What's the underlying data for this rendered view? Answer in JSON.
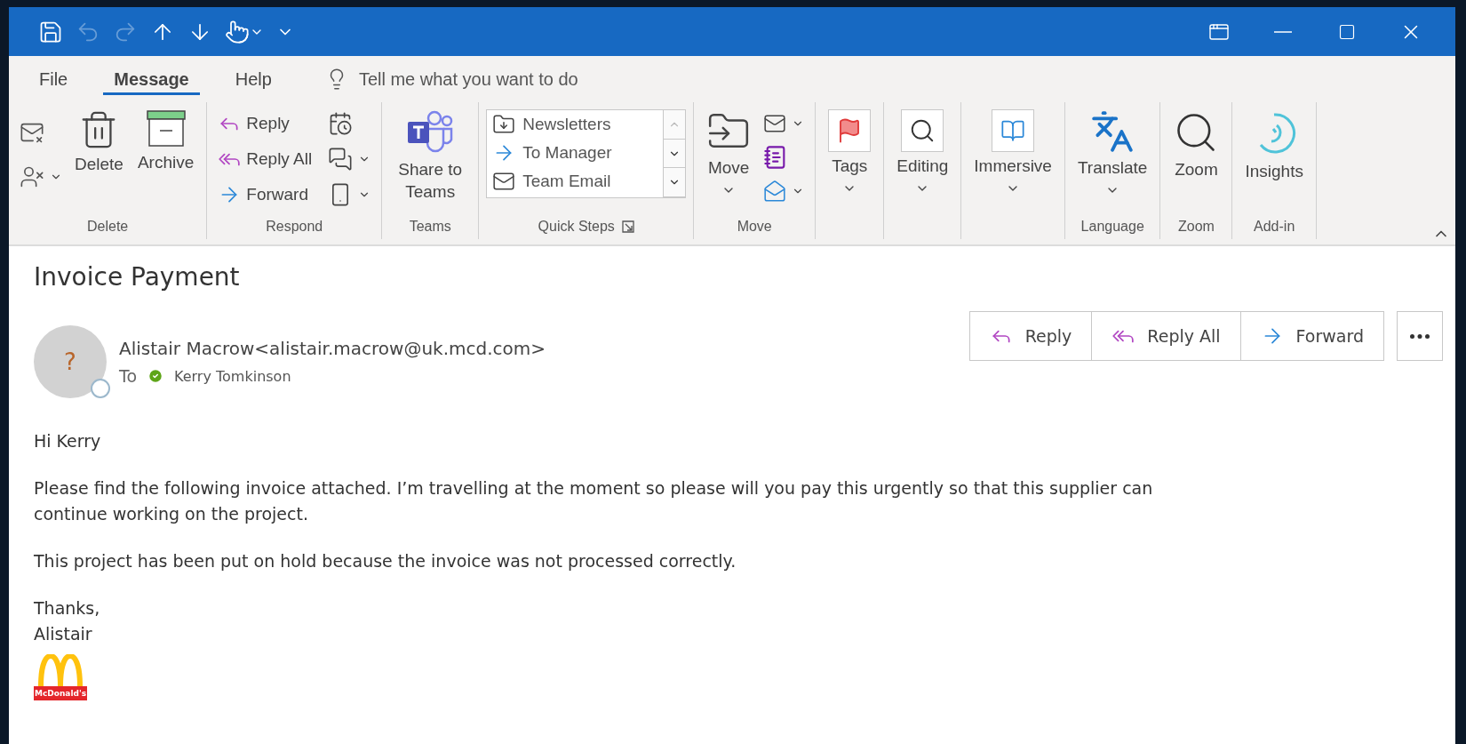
{
  "quick_access": [
    {
      "kind": "save",
      "disabled": false
    },
    {
      "kind": "undo",
      "disabled": true
    },
    {
      "kind": "redo",
      "disabled": true
    },
    {
      "kind": "up",
      "disabled": false
    },
    {
      "kind": "down",
      "disabled": false
    },
    {
      "kind": "touch",
      "disabled": false
    },
    {
      "kind": "customize",
      "disabled": false
    }
  ],
  "menu_tabs": [
    {
      "label": "File",
      "selected": false
    },
    {
      "label": "Message",
      "selected": true
    },
    {
      "label": "Help",
      "selected": false
    }
  ],
  "tell_me": {
    "placeholder": "Tell me what you want to do"
  },
  "ribbon_groups": [
    {
      "kind": "delete",
      "label": "Delete",
      "buttons": [
        "Delete",
        "Archive"
      ]
    },
    {
      "kind": "respond",
      "label": "Respond",
      "buttons": [
        "Reply",
        "Reply All",
        "Forward"
      ]
    },
    {
      "kind": "big",
      "label": "Teams",
      "button": "Share to Teams",
      "dropdown": false
    },
    {
      "kind": "quick_steps",
      "label": "Quick Steps",
      "items": [
        "Newsletters",
        "To Manager",
        "Team Email"
      ]
    },
    {
      "kind": "move",
      "label": "Move",
      "button": "Move"
    },
    {
      "kind": "big",
      "button": "Tags",
      "dropdown": true
    },
    {
      "kind": "big",
      "button": "Editing",
      "dropdown": true
    },
    {
      "kind": "big",
      "button": "Immersive",
      "dropdown": true
    },
    {
      "kind": "big",
      "label": "Language",
      "button": "Translate",
      "dropdown": true
    },
    {
      "kind": "big",
      "label": "Zoom",
      "button": "Zoom",
      "dropdown": false
    },
    {
      "kind": "big",
      "label": "Add-in",
      "button": "Insights",
      "dropdown": false
    }
  ],
  "email": {
    "subject": "Invoice Payment",
    "avatar_text": "?",
    "sender": "Alistair Macrow<alistair.macrow@uk.mcd.com>",
    "to_label": "To",
    "recipient": "Kerry Tomkinson",
    "actions": [
      "Reply",
      "Reply All",
      "Forward"
    ],
    "body": [
      "Hi Kerry",
      "Please find the following invoice attached. I’m travelling at the moment so please will you pay this urgently so that this supplier can continue working on the project.",
      "This project has been put on hold because the invoice was not processed correctly."
    ],
    "signoff": [
      "Thanks,",
      "Alistair"
    ],
    "logo_text": "McDonald's"
  }
}
